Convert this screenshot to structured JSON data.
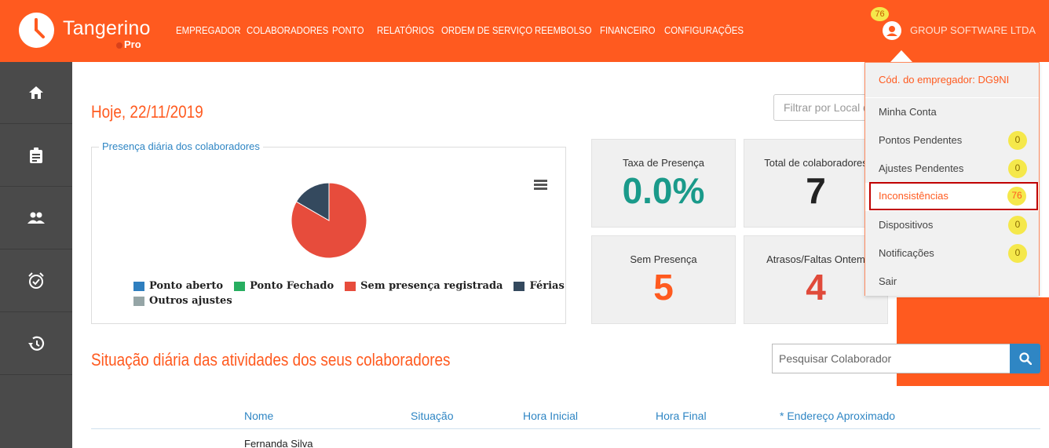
{
  "header": {
    "brand": "Tangerino",
    "brand_sub": "Pro",
    "nav": [
      "EMPREGADOR",
      "COLABORADORES",
      "PONTO",
      "RELATÓRIOS",
      "ORDEM DE SERVIÇO",
      "REEMBOLSO",
      "FINANCEIRO",
      "CONFIGURAÇÕES"
    ],
    "user_badge": "76",
    "user_name": "GROUP SOFTWARE LTDA"
  },
  "sidebar": {
    "icons": [
      "home-icon",
      "clipboard-icon",
      "people-icon",
      "alarm-clock-icon",
      "history-icon"
    ]
  },
  "main": {
    "title": "Hoje, 22/11/2019",
    "filter_placeholder": "Filtrar por Local de",
    "chart_title": "Presença diária dos colaboradores",
    "stats": [
      {
        "label": "Taxa de Presença",
        "value": "0.0%",
        "color": "#1a9a8a"
      },
      {
        "label": "Total de colaboradores",
        "value": "7",
        "color": "#222222"
      },
      {
        "label": "Sem Presença",
        "value": "5",
        "color": "#ff5a1f"
      },
      {
        "label": "Atrasos/Faltas Ontem",
        "value": "4",
        "color": "#e04a3a"
      }
    ],
    "section_title": "Situação diária das atividades dos seus colaboradores",
    "search_placeholder": "Pesquisar Colaborador",
    "table_headers": [
      "Nome",
      "Situação",
      "Hora Inicial",
      "Hora Final",
      "* Endereço Aproximado"
    ],
    "rows": [
      {
        "name": "Fernanda Silva"
      }
    ]
  },
  "chart_data": {
    "type": "pie",
    "title": "Presença diária dos colaboradores",
    "legend_position": "bottom",
    "series": [
      {
        "name": "Ponto aberto",
        "value": 0,
        "color": "#2f7fbf"
      },
      {
        "name": "Ponto Fechado",
        "value": 0,
        "color": "#27ae60"
      },
      {
        "name": "Sem presença registrada",
        "value": 5,
        "color": "#e74c3c"
      },
      {
        "name": "Férias",
        "value": 1,
        "color": "#34495e"
      },
      {
        "name": "Outros ajustes",
        "value": 0,
        "color": "#95a5a6"
      }
    ]
  },
  "dropdown": {
    "employer_code": "Cód. do empregador: DG9NI",
    "items": [
      {
        "label": "Minha Conta",
        "badge": ""
      },
      {
        "label": "Pontos Pendentes",
        "badge": "0"
      },
      {
        "label": "Ajustes Pendentes",
        "badge": "0"
      },
      {
        "label": "Inconsistências",
        "badge": "76"
      },
      {
        "label": "Dispositivos",
        "badge": "0"
      },
      {
        "label": "Notificações",
        "badge": "0"
      },
      {
        "label": "Sair",
        "badge": ""
      }
    ]
  }
}
